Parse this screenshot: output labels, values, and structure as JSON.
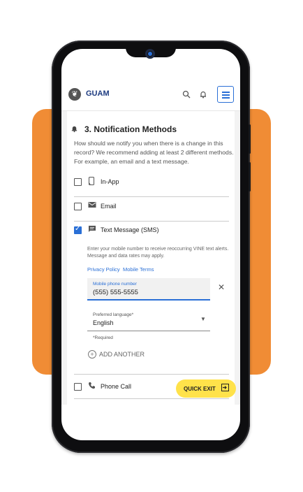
{
  "app": {
    "title": "GUAM",
    "logo_glyph": "❦"
  },
  "header": {
    "search_icon": "search-icon",
    "bell_icon": "bell-icon",
    "menu_icon": "menu-icon"
  },
  "section": {
    "title": "3. Notification Methods",
    "description": "How should we notify you when there is a change in this record? We recommend adding at least 2 different methods. For example, an email and a text message."
  },
  "methods": [
    {
      "label": "In-App",
      "checked": false,
      "icon": "phone-app-icon"
    },
    {
      "label": "Email",
      "checked": false,
      "icon": "envelope-icon"
    },
    {
      "label": "Text Message (SMS)",
      "checked": true,
      "icon": "chat-icon"
    },
    {
      "label": "Phone Call",
      "checked": false,
      "icon": "phone-icon"
    }
  ],
  "sms": {
    "help": "Enter your mobile number to receive reoccurring VINE text alerts. Message and data rates may apply.",
    "privacy_link": "Privacy Policy",
    "terms_link": "Mobile Terms",
    "phone_label": "Mobile phone number",
    "phone_value": "(555) 555-5555",
    "language_label": "Preferred language*",
    "language_value": "English",
    "required_note": "*Required",
    "add_another": "ADD ANOTHER"
  },
  "quick_exit": {
    "label": "QUICK EXIT"
  },
  "colors": {
    "accent": "#2a6fd6",
    "orange": "#F08C35",
    "quick_exit": "#FFE24A",
    "title": "#1d3b80"
  }
}
